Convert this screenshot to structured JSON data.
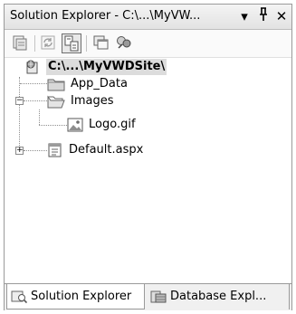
{
  "window": {
    "title": "Solution Explorer - C:\\...\\MyVW...",
    "dropdown_glyph": "▾",
    "pin_glyph": "ᛉ",
    "close_glyph": "✕"
  },
  "toolbar": {
    "buttons": [
      {
        "icon": "properties-icon"
      },
      {
        "icon": "refresh-icon"
      },
      {
        "icon": "nest-related-files-icon",
        "active": true
      },
      {
        "icon": "copy-website-icon"
      },
      {
        "icon": "asp-net-configuration-icon"
      }
    ]
  },
  "tree": {
    "root": "C:\\...\\MyVWDSite\\",
    "items": [
      {
        "label": "App_Data",
        "icon": "folder-icon"
      },
      {
        "label": "Images",
        "icon": "open-folder-icon",
        "expanded": true
      },
      {
        "label": "Logo.gif",
        "icon": "image-file-icon"
      },
      {
        "label": "Default.aspx",
        "icon": "web-form-icon",
        "collapsed": true
      }
    ],
    "expanded_glyph": "−",
    "collapsed_glyph": "+"
  },
  "tabs": [
    {
      "label": "Solution Explorer",
      "icon": "solution-explorer-icon",
      "active": true
    },
    {
      "label": "Database Expl...",
      "icon": "database-explorer-icon",
      "active": false
    }
  ]
}
